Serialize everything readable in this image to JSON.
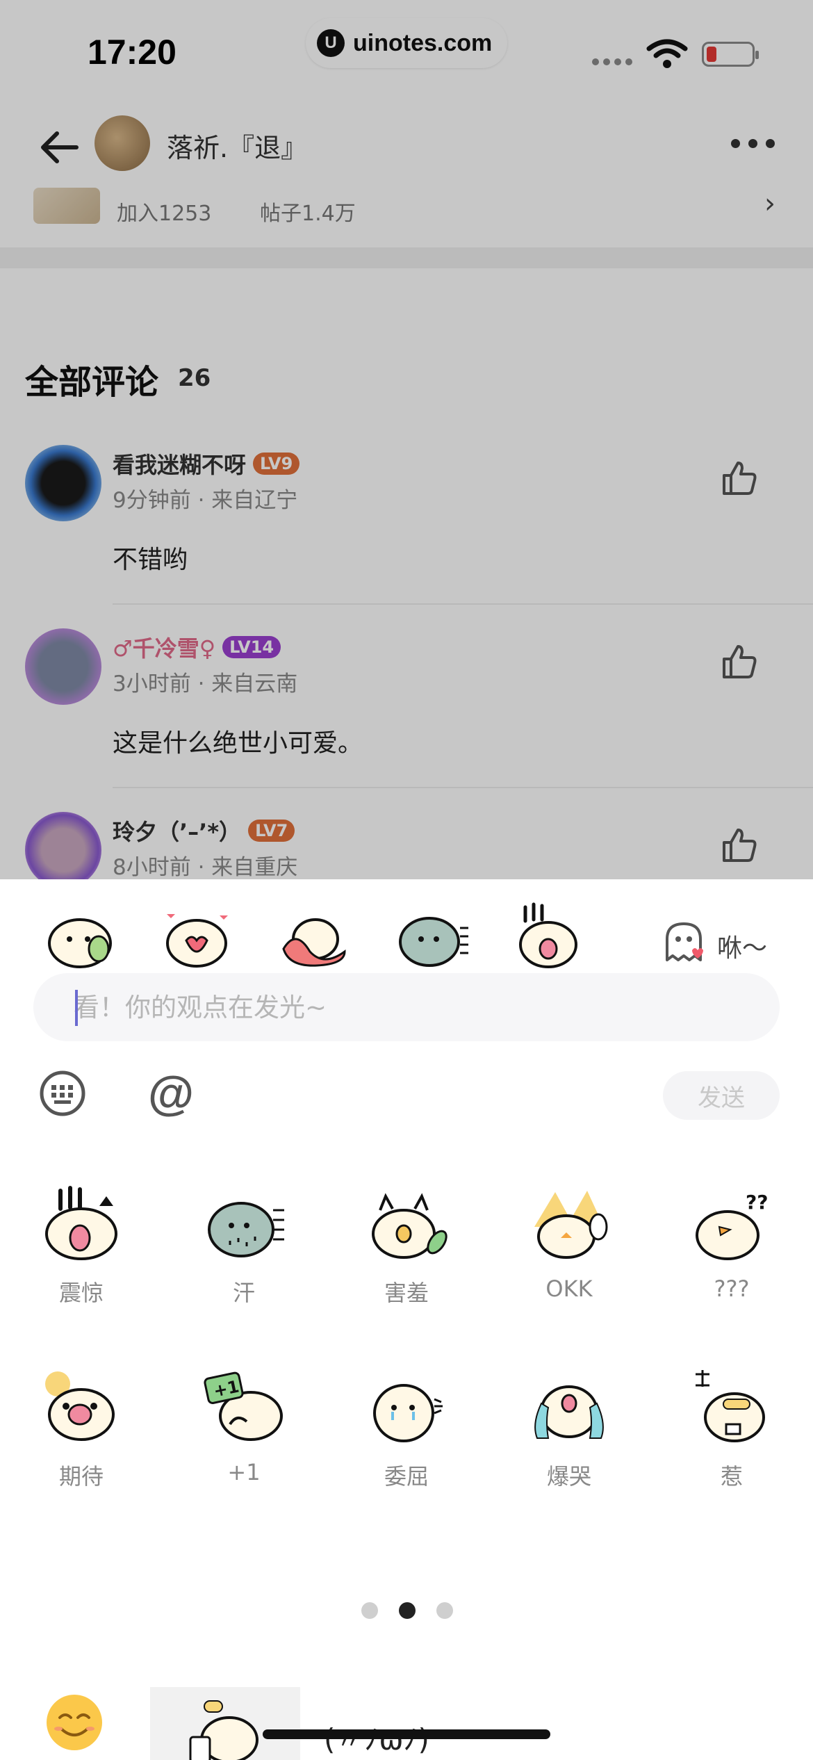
{
  "status": {
    "time": "17:20",
    "site": "uinotes.com"
  },
  "nav": {
    "title": "落祈.『退』"
  },
  "group": {
    "joined": "加入1253",
    "posts": "帖子1.4万"
  },
  "comments_section": {
    "title": "全部评论",
    "count": "26"
  },
  "comments": [
    {
      "name": "看我迷糊不呀",
      "level": "LV9",
      "level_color": "#e0703a",
      "meta": "9分钟前 · 来自辽宁",
      "text": "不错哟"
    },
    {
      "name": "♂千冷雪♀",
      "level": "LV14",
      "level_color": "#9a3fd0",
      "name_color": "#e06a8a",
      "meta": "3小时前 · 来自云南",
      "text": "这是什么绝世小可爱。"
    },
    {
      "name": "玲夕（’–’*）",
      "level": "LV7",
      "level_color": "#e0703a",
      "meta": "8小时前 · 来自重庆",
      "text": ""
    }
  ],
  "composer": {
    "greeting_label": "咻～",
    "placeholder": "看！你的观点在发光~",
    "send_label": "发送"
  },
  "stickers": [
    {
      "label": "震惊"
    },
    {
      "label": "汗"
    },
    {
      "label": "害羞"
    },
    {
      "label": "OKK"
    },
    {
      "label": "???"
    },
    {
      "label": "期待"
    },
    {
      "label": "+1"
    },
    {
      "label": "委屈"
    },
    {
      "label": "爆哭"
    },
    {
      "label": "惹"
    }
  ],
  "pagination": {
    "current": 2,
    "total": 3
  },
  "bottom_bar": {
    "kaomoji": "(〃ﾉωﾉ)"
  }
}
